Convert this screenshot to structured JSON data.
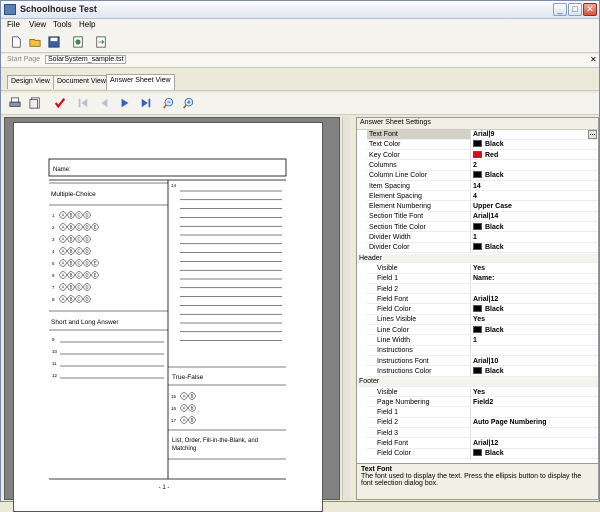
{
  "window": {
    "title": "Schoolhouse Test"
  },
  "menu": [
    "File",
    "View",
    "Tools",
    "Help"
  ],
  "toolbar": {
    "icons": [
      "new-icon",
      "open-icon",
      "save-icon",
      "print-setup-icon",
      "export-icon"
    ]
  },
  "doc_tabs": {
    "start": "Start Page",
    "file": "SolarSystem_sample.tst"
  },
  "view_tabs": [
    "Design View",
    "Document View",
    "Answer Sheet View"
  ],
  "page": {
    "name_label": "Name:",
    "sections": {
      "mc": "Multiple-Choice",
      "short": "Short and Long Answer",
      "tf": "True-False",
      "list": "List, Order, Fill-in-the-Blank, and Matching"
    },
    "mc_rows": [
      {
        "n": "1",
        "o": [
          "A",
          "B",
          "C",
          "D"
        ]
      },
      {
        "n": "2",
        "o": [
          "A",
          "B",
          "C",
          "D",
          "E"
        ]
      },
      {
        "n": "3",
        "o": [
          "A",
          "B",
          "C",
          "D"
        ]
      },
      {
        "n": "4",
        "o": [
          "A",
          "B",
          "C",
          "D"
        ]
      },
      {
        "n": "5",
        "o": [
          "A",
          "B",
          "C",
          "D",
          "E"
        ]
      },
      {
        "n": "6",
        "o": [
          "A",
          "B",
          "C",
          "D",
          "E"
        ]
      },
      {
        "n": "7",
        "o": [
          "A",
          "B",
          "C",
          "D"
        ]
      },
      {
        "n": "8",
        "o": [
          "A",
          "B",
          "C",
          "D"
        ]
      }
    ],
    "short_numbers": [
      "9",
      "10",
      "11",
      "12"
    ],
    "right_number": "14",
    "tf_rows": [
      {
        "n": "15"
      },
      {
        "n": "16"
      },
      {
        "n": "17"
      }
    ],
    "footer": "- 1 -"
  },
  "panel": {
    "title": "Answer Sheet Settings",
    "rows": [
      {
        "name": "Text Font",
        "value": "Arial|9",
        "sel": true
      },
      {
        "name": "Text Color",
        "value": "Black",
        "swatch": "#000000"
      },
      {
        "name": "Key Color",
        "value": "Red",
        "swatch": "#d01010"
      },
      {
        "name": "Columns",
        "value": "2"
      },
      {
        "name": "Column Line Color",
        "value": "Black",
        "swatch": "#000000"
      },
      {
        "name": "Item Spacing",
        "value": "14"
      },
      {
        "name": "Element Spacing",
        "value": "4"
      },
      {
        "name": "Element Numbering",
        "value": "Upper Case"
      },
      {
        "name": "Section Title Font",
        "value": "Arial|14"
      },
      {
        "name": "Section Title Color",
        "value": "Black",
        "swatch": "#000000"
      },
      {
        "name": "Divider Width",
        "value": "1"
      },
      {
        "name": "Divider Color",
        "value": "Black",
        "swatch": "#000000"
      },
      {
        "name": "Header",
        "cat": true
      },
      {
        "name": "Visible",
        "value": "Yes",
        "ind": true
      },
      {
        "name": "Field 1",
        "value": "Name:",
        "ind": true
      },
      {
        "name": "Field 2",
        "value": "",
        "ind": true
      },
      {
        "name": "Field Font",
        "value": "Arial|12",
        "ind": true
      },
      {
        "name": "Field Color",
        "value": "Black",
        "swatch": "#000000",
        "ind": true
      },
      {
        "name": "Lines  Visible",
        "value": "Yes",
        "ind": true
      },
      {
        "name": "Line Color",
        "value": "Black",
        "swatch": "#000000",
        "ind": true
      },
      {
        "name": "Line Width",
        "value": "1",
        "ind": true
      },
      {
        "name": "Instructions",
        "value": "",
        "ind": true
      },
      {
        "name": "Instructions Font",
        "value": "Arial|10",
        "ind": true
      },
      {
        "name": "Instructions Color",
        "value": "Black",
        "swatch": "#000000",
        "ind": true
      },
      {
        "name": "Footer",
        "cat": true
      },
      {
        "name": "Visible",
        "value": "Yes",
        "ind": true
      },
      {
        "name": "Page Numbering",
        "value": "Field2",
        "ind": true
      },
      {
        "name": "Field 1",
        "value": "",
        "ind": true
      },
      {
        "name": "Field 2",
        "value": "Auto Page Numbering",
        "ind": true
      },
      {
        "name": "Field 3",
        "value": "",
        "ind": true
      },
      {
        "name": "Field Font",
        "value": "Arial|12",
        "ind": true
      },
      {
        "name": "Field Color",
        "value": "Black",
        "swatch": "#000000",
        "ind": true
      }
    ],
    "desc_title": "Text Font",
    "desc_text": "The font used to display the text. Press the ellipsis button to display the font selection dialog box."
  }
}
